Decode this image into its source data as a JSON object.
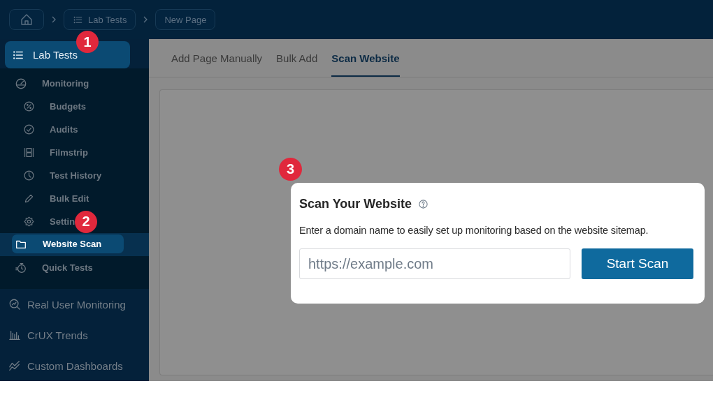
{
  "breadcrumbs": [
    {
      "kind": "home"
    },
    {
      "kind": "list",
      "label": "Lab Tests",
      "callout": "1"
    },
    {
      "kind": "page",
      "label": "New Page"
    }
  ],
  "sidebar": {
    "section": {
      "label": "Lab Tests",
      "selected": true
    },
    "items": [
      {
        "label": "Monitoring",
        "kind": "gauge",
        "selected": false,
        "children": [
          {
            "label": "Budgets",
            "kind": "percent",
            "selected": false
          },
          {
            "label": "Audits",
            "kind": "check",
            "selected": false
          },
          {
            "label": "Filmstrip",
            "kind": "film",
            "selected": false
          },
          {
            "label": "Test History",
            "kind": "clock",
            "selected": false
          },
          {
            "label": "Bulk Edit",
            "kind": "pencil",
            "selected": false
          },
          {
            "label": "Settin",
            "kind": "gear",
            "selected": false,
            "callout": "2"
          }
        ]
      },
      {
        "label": "Website Scan",
        "kind": "folder",
        "selected": true
      },
      {
        "label": "Quick Tests",
        "kind": "stopwatch",
        "selected": false
      }
    ],
    "other": [
      {
        "label": "Real User Monitoring",
        "kind": "magnifier"
      },
      {
        "label": "CrUX Trends",
        "kind": "bars"
      },
      {
        "label": "Custom Dashboards",
        "kind": "lines"
      }
    ]
  },
  "tabs": [
    {
      "label": "Add Page Manually",
      "selected": false
    },
    {
      "label": "Bulk Add",
      "selected": false
    },
    {
      "label": "Scan Website",
      "selected": true
    }
  ],
  "scan_card": {
    "callout": "3",
    "title": "Scan Your Website",
    "description": "Enter a domain name to easily set up monitoring based on the website sitemap.",
    "url_field": {
      "placeholder": "https://example.com"
    },
    "button": "Start Scan"
  }
}
